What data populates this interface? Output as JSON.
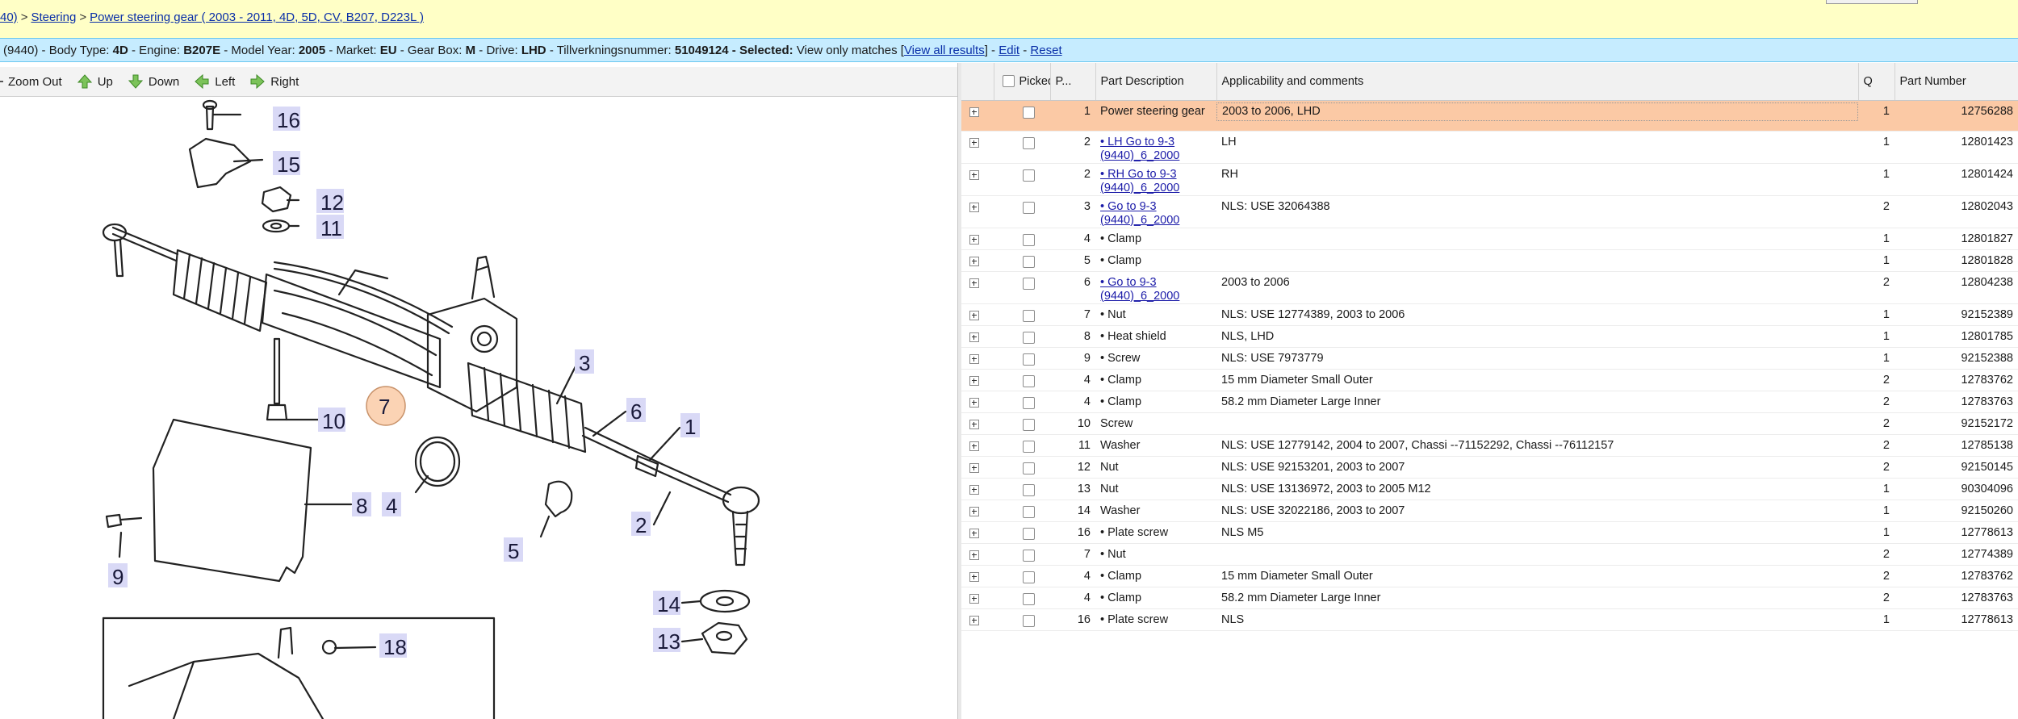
{
  "breadcrumb": {
    "items": [
      "40)",
      "Steering",
      "Power steering gear ( 2003 - 2011, 4D, 5D, CV, B207, D223L )"
    ],
    "separator": ">"
  },
  "infobar": {
    "prefix": "(9440) - Body Type:",
    "body_type": "4D",
    "engine_label": "- Engine:",
    "engine": "B207E",
    "model_year_label": "- Model Year:",
    "model_year": "2005",
    "market_label": "- Market:",
    "market": "EU",
    "gearbox_label": "- Gear Box:",
    "gearbox": "M",
    "drive_label": "- Drive:",
    "drive": "LHD",
    "tillv_label": "- Tillverkningsnummer:",
    "tillv": "51049124",
    "selected_label": "- Selected:",
    "selected_text": "View only matches [",
    "view_all": "View all results",
    "after_view_all": "] -",
    "edit": "Edit",
    "dash": "-",
    "reset": "Reset"
  },
  "toolbar": {
    "zoom_out": "Zoom Out",
    "up": "Up",
    "down": "Down",
    "left": "Left",
    "right": "Right"
  },
  "diagram": {
    "callouts": [
      "16",
      "15",
      "12",
      "11",
      "3",
      "6",
      "7",
      "1",
      "10",
      "4",
      "8",
      "5",
      "2",
      "9",
      "14",
      "13",
      "18"
    ]
  },
  "table": {
    "headers": {
      "picked": "Picked",
      "pos": "P...",
      "description": "Part Description",
      "applicability": "Applicability and comments",
      "qty": "Q",
      "part_number": "Part Number"
    },
    "rows": [
      {
        "pos": "1",
        "desc": "Power steering gear",
        "link": false,
        "comment": "2003 to 2006, LHD",
        "qty": "1",
        "pn": "12756288",
        "selected": true
      },
      {
        "pos": "2",
        "desc": "• LH Go to 9-3 (9440)_6_2000",
        "link": true,
        "comment": "LH",
        "qty": "1",
        "pn": "12801423"
      },
      {
        "pos": "2",
        "desc": "• RH Go to 9-3 (9440)_6_2000",
        "link": true,
        "comment": "RH",
        "qty": "1",
        "pn": "12801424"
      },
      {
        "pos": "3",
        "desc": "• Go to 9-3 (9440)_6_2000",
        "link": true,
        "comment": "NLS: USE 32064388",
        "qty": "2",
        "pn": "12802043"
      },
      {
        "pos": "4",
        "desc": "• Clamp",
        "link": false,
        "comment": "",
        "qty": "1",
        "pn": "12801827"
      },
      {
        "pos": "5",
        "desc": "• Clamp",
        "link": false,
        "comment": "",
        "qty": "1",
        "pn": "12801828"
      },
      {
        "pos": "6",
        "desc": "• Go to 9-3 (9440)_6_2000",
        "link": true,
        "comment": "2003 to 2006",
        "qty": "2",
        "pn": "12804238"
      },
      {
        "pos": "7",
        "desc": "• Nut",
        "link": false,
        "comment": "NLS: USE 12774389, 2003 to 2006",
        "qty": "1",
        "pn": "92152389"
      },
      {
        "pos": "8",
        "desc": "• Heat shield",
        "link": false,
        "comment": "NLS, LHD",
        "qty": "1",
        "pn": "12801785"
      },
      {
        "pos": "9",
        "desc": "• Screw",
        "link": false,
        "comment": "NLS: USE 7973779",
        "qty": "1",
        "pn": "92152388"
      },
      {
        "pos": "4",
        "desc": "• Clamp",
        "link": false,
        "comment": "15 mm Diameter Small Outer",
        "qty": "2",
        "pn": "12783762"
      },
      {
        "pos": "4",
        "desc": "• Clamp",
        "link": false,
        "comment": "58.2 mm Diameter Large Inner",
        "qty": "2",
        "pn": "12783763"
      },
      {
        "pos": "10",
        "desc": "Screw",
        "link": false,
        "comment": "",
        "qty": "2",
        "pn": "92152172"
      },
      {
        "pos": "11",
        "desc": "Washer",
        "link": false,
        "comment": "NLS: USE 12779142, 2004 to 2007, Chassi --71152292, Chassi --76112157",
        "qty": "2",
        "pn": "12785138"
      },
      {
        "pos": "12",
        "desc": "Nut",
        "link": false,
        "comment": "NLS: USE 92153201, 2003 to 2007",
        "qty": "2",
        "pn": "92150145"
      },
      {
        "pos": "13",
        "desc": "Nut",
        "link": false,
        "comment": "NLS: USE 13136972, 2003 to 2005 M12",
        "qty": "1",
        "pn": "90304096"
      },
      {
        "pos": "14",
        "desc": "Washer",
        "link": false,
        "comment": "NLS: USE 32022186, 2003 to 2007",
        "qty": "1",
        "pn": "92150260"
      },
      {
        "pos": "16",
        "desc": "• Plate screw",
        "link": false,
        "comment": "NLS M5",
        "qty": "1",
        "pn": "12778613"
      },
      {
        "pos": "7",
        "desc": "• Nut",
        "link": false,
        "comment": "",
        "qty": "2",
        "pn": "12774389"
      },
      {
        "pos": "4",
        "desc": "• Clamp",
        "link": false,
        "comment": "15 mm Diameter Small Outer",
        "qty": "2",
        "pn": "12783762"
      },
      {
        "pos": "4",
        "desc": "• Clamp",
        "link": false,
        "comment": "58.2 mm Diameter Large Inner",
        "qty": "2",
        "pn": "12783763"
      },
      {
        "pos": "16",
        "desc": "• Plate screw",
        "link": false,
        "comment": "NLS",
        "qty": "1",
        "pn": "12778613"
      }
    ]
  },
  "colors": {
    "breadcrumb_bg": "#ffffc6",
    "infobar_bg": "#c6ecff",
    "selected_row": "#fbc9a5",
    "callout_bg": "#d9d9f6",
    "highlight_callout": "#fbd3b4"
  }
}
